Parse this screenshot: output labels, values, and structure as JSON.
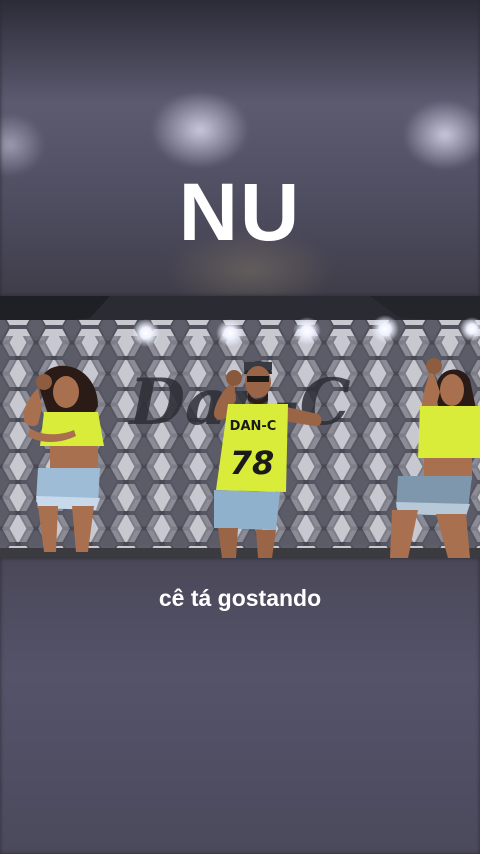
{
  "overlay": {
    "title": "NU",
    "caption": "cê tá gostando"
  },
  "video": {
    "jersey_text": "DAN-C",
    "jersey_number": "78",
    "wall_logo": "Dan-C"
  },
  "colors": {
    "neon_yellow": "#d9ec3a",
    "denim": "#8fb1cc",
    "wall": "#5e5e6a"
  }
}
